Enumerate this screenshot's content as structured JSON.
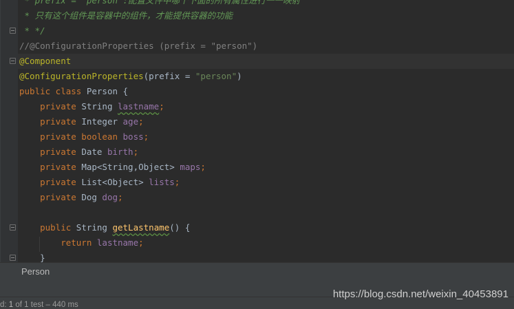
{
  "editor": {
    "lines": [
      [
        {
          "t": " * prefix = \"person\":配置文件中哪个下面的所有属性进行一一映射",
          "c": "cm"
        }
      ],
      [
        {
          "t": " * 只有这个组件是容器中的组件，才能提供容器的功能",
          "c": "cm"
        }
      ],
      [
        {
          "t": " * */",
          "c": "cm"
        }
      ],
      [
        {
          "t": "//@ConfigurationProperties (prefix = \"person\")",
          "c": "cm-plain"
        }
      ],
      [
        {
          "t": "@Component",
          "c": "ann"
        }
      ],
      [
        {
          "t": "@ConfigurationProperties",
          "c": "ann"
        },
        {
          "t": "(prefix = ",
          "c": ""
        },
        {
          "t": "\"person\"",
          "c": "str"
        },
        {
          "t": ")",
          "c": ""
        }
      ],
      [
        {
          "t": "public class ",
          "c": "kw"
        },
        {
          "t": "Person {",
          "c": ""
        }
      ],
      [
        {
          "t": "    private ",
          "c": "kw"
        },
        {
          "t": "String ",
          "c": ""
        },
        {
          "t": "lastname",
          "c": "fld squig"
        },
        {
          "t": ";",
          "c": "kw"
        }
      ],
      [
        {
          "t": "    private ",
          "c": "kw"
        },
        {
          "t": "Integer ",
          "c": ""
        },
        {
          "t": "age",
          "c": "fld"
        },
        {
          "t": ";",
          "c": "kw"
        }
      ],
      [
        {
          "t": "    private boolean ",
          "c": "kw"
        },
        {
          "t": "boss",
          "c": "fld"
        },
        {
          "t": ";",
          "c": "kw"
        }
      ],
      [
        {
          "t": "    private ",
          "c": "kw"
        },
        {
          "t": "Date ",
          "c": ""
        },
        {
          "t": "birth",
          "c": "fld"
        },
        {
          "t": ";",
          "c": "kw"
        }
      ],
      [
        {
          "t": "    private ",
          "c": "kw"
        },
        {
          "t": "Map<String,Object> ",
          "c": ""
        },
        {
          "t": "maps",
          "c": "fld"
        },
        {
          "t": ";",
          "c": "kw"
        }
      ],
      [
        {
          "t": "    private ",
          "c": "kw"
        },
        {
          "t": "List<Object> ",
          "c": ""
        },
        {
          "t": "lists",
          "c": "fld"
        },
        {
          "t": ";",
          "c": "kw"
        }
      ],
      [
        {
          "t": "    private ",
          "c": "kw"
        },
        {
          "t": "Dog ",
          "c": ""
        },
        {
          "t": "dog",
          "c": "fld"
        },
        {
          "t": ";",
          "c": "kw"
        }
      ],
      [],
      [
        {
          "t": "    public ",
          "c": "kw"
        },
        {
          "t": "String ",
          "c": ""
        },
        {
          "t": "getLastname",
          "c": "mth squig"
        },
        {
          "t": "() {",
          "c": ""
        }
      ],
      [
        {
          "t": "        return ",
          "c": "kw"
        },
        {
          "t": "lastname",
          "c": "fld"
        },
        {
          "t": ";",
          "c": "kw"
        }
      ],
      [
        {
          "t": "    }",
          "c": ""
        }
      ]
    ]
  },
  "breadcrumb": {
    "label": "Person"
  },
  "run_status": {
    "prefix": "d: ",
    "passed": "1",
    "of_text": " of 1 test",
    "duration": " – 440 ms"
  },
  "watermark": {
    "text": "https://blog.csdn.net/weixin_40453891"
  },
  "colors": {
    "background": "#2b2b2b",
    "keyword": "#cc7832",
    "annotation": "#bbb529",
    "string": "#6a8759",
    "field": "#9876aa",
    "method": "#ffc66d",
    "comment": "#629755"
  }
}
